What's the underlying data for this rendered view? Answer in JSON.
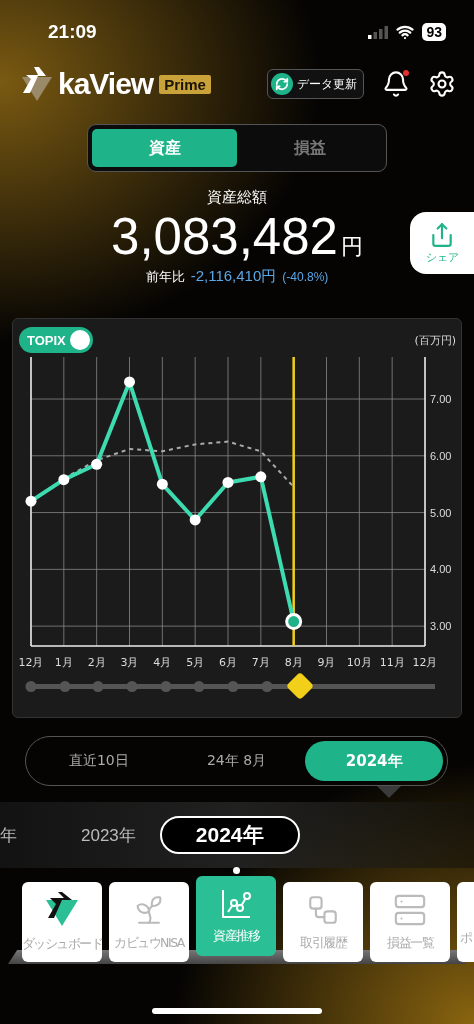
{
  "status_bar": {
    "time": "21:09",
    "battery": "93"
  },
  "header": {
    "logo": "kaView",
    "badge": "Prime",
    "refresh_label": "データ更新",
    "notification_unread": true
  },
  "tabs": [
    {
      "label": "資産",
      "selected": true
    },
    {
      "label": "損益",
      "selected": false
    }
  ],
  "summary": {
    "title": "資産総額",
    "amount": "3,083,482",
    "unit": "円",
    "compare_label": "前年比",
    "change": "-2,116,410円",
    "change_percent": "(-40.8%)"
  },
  "share": {
    "label": "シェア"
  },
  "chart": {
    "toggle": {
      "on": true
    },
    "slider": {
      "level": 0.667
    },
    "chart_data": {
      "type": "line",
      "ylabel": "(百万円)",
      "grid": true,
      "categories": [
        "12月",
        "1月",
        "2月",
        "3月",
        "4月",
        "5月",
        "6月",
        "7月",
        "8月",
        "9月",
        "10月",
        "11月",
        "12月"
      ],
      "series": [
        {
          "color": "#3ddbb0",
          "marker": "circle",
          "values": [
            5.2,
            5.58,
            5.85,
            7.3,
            5.5,
            4.87,
            5.53,
            5.63,
            3.08,
            null,
            null,
            null,
            null
          ]
        },
        {
          "name": "TOPIX",
          "color": "#aaaaaa",
          "line_style": "dashed",
          "values": [
            null,
            5.6,
            5.92,
            6.12,
            6.08,
            6.2,
            6.25,
            6.08,
            5.45,
            null,
            null,
            null,
            null
          ]
        }
      ],
      "ref_lines": [
        {
          "axis": "x",
          "value": "8月",
          "color": "#f2d01a"
        }
      ],
      "ylim": [
        2.65,
        7.74
      ],
      "yticks": [
        {
          "value": 3,
          "label": "3.00"
        },
        {
          "value": 4,
          "label": "4.00"
        },
        {
          "value": 5,
          "label": "5.00"
        },
        {
          "value": 6,
          "label": "6.00"
        },
        {
          "value": 7,
          "label": "7.00"
        }
      ]
    }
  },
  "periods": [
    {
      "label": "直近10日",
      "selected": false
    },
    {
      "label": "24年 8月",
      "selected": false
    },
    {
      "label": "2024年",
      "selected": true
    }
  ],
  "years": [
    {
      "label": "年",
      "selected": false
    },
    {
      "label": "2023年",
      "selected": false
    },
    {
      "label": "2024年",
      "selected": true
    }
  ],
  "nav": [
    {
      "label": "ダッシュボード",
      "kind": "logo",
      "selected": false
    },
    {
      "label": "カビュウNISA",
      "kind": "sprout",
      "selected": false
    },
    {
      "label": "資産推移",
      "kind": "chart",
      "selected": true
    },
    {
      "label": "取引履歴",
      "kind": "history",
      "selected": false
    },
    {
      "label": "損益一覧",
      "kind": "list",
      "selected": false
    },
    {
      "label": "ポ",
      "kind": "blank",
      "selected": false
    }
  ]
}
